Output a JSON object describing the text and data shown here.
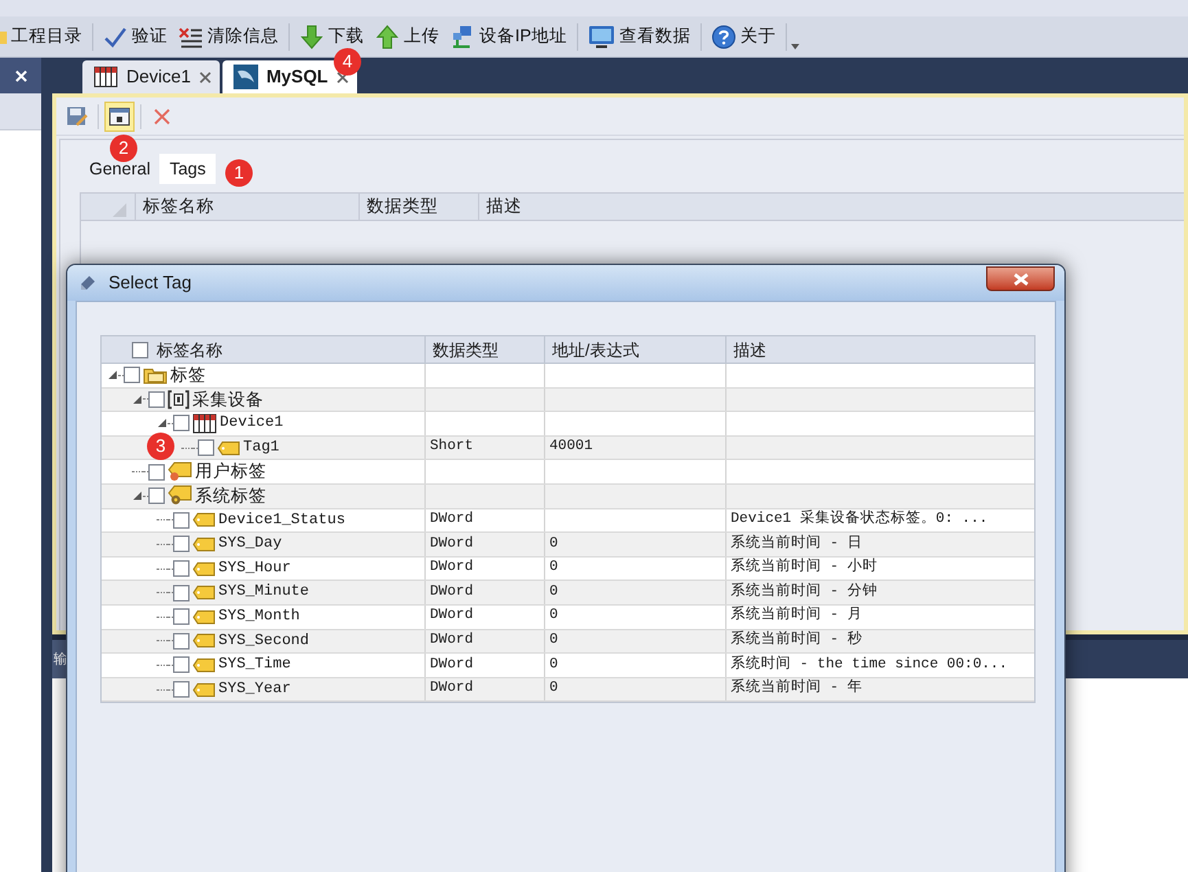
{
  "toolbar": [
    {
      "label": "工程目录",
      "kind": "folder"
    },
    {
      "label": "验证",
      "kind": "check"
    },
    {
      "label": "清除信息",
      "kind": "clear"
    },
    {
      "label": "下载",
      "kind": "download"
    },
    {
      "label": "上传",
      "kind": "upload"
    },
    {
      "label": "设备IP地址",
      "kind": "network"
    },
    {
      "label": "查看数据",
      "kind": "monitor"
    },
    {
      "label": "关于",
      "kind": "help"
    }
  ],
  "document_tabs": [
    {
      "label": "Device1",
      "kind": "device",
      "selected": false
    },
    {
      "label": "MySQL",
      "kind": "database",
      "selected": true
    }
  ],
  "editor": {
    "tools": [
      {
        "kind": "save",
        "hover": false
      },
      {
        "kind": "add",
        "hover": true
      },
      {
        "kind": "delete",
        "hover": false
      }
    ],
    "tabs": [
      {
        "label": "General",
        "selected": false
      },
      {
        "label": "Tags",
        "selected": true
      }
    ],
    "columns": [
      "标签名称",
      "数据类型",
      "描述"
    ]
  },
  "output_panel": {
    "title": "输"
  },
  "dialog": {
    "title": "Select Tag",
    "all_checked": false,
    "columns": [
      "标签名称",
      "数据类型",
      "地址/表达式",
      "描述"
    ],
    "tree": [
      {
        "name": "标签",
        "kind": "root",
        "checked": false,
        "expanded": true,
        "children": [
          {
            "name": "采集设备",
            "kind": "collector",
            "checked": false,
            "expanded": true,
            "children": [
              {
                "name": "Device1",
                "kind": "device",
                "checked": false,
                "expanded": true,
                "children": [
                  {
                    "name": "Tag1",
                    "kind": "tag",
                    "checked": false,
                    "type": "Short",
                    "address": "40001"
                  }
                ]
              }
            ]
          },
          {
            "name": "用户标签",
            "kind": "user",
            "checked": false
          },
          {
            "name": "系统标签",
            "kind": "system",
            "checked": false,
            "expanded": true,
            "children": [
              {
                "name": "Device1_Status",
                "kind": "tag",
                "checked": false,
                "type": "DWord",
                "description": "Device1 采集设备状态标签。0: ..."
              },
              {
                "name": "SYS_Day",
                "kind": "tag",
                "checked": false,
                "type": "DWord",
                "address": "0",
                "description": "系统当前时间 - 日"
              },
              {
                "name": "SYS_Hour",
                "kind": "tag",
                "checked": false,
                "type": "DWord",
                "address": "0",
                "description": "系统当前时间 - 小时"
              },
              {
                "name": "SYS_Minute",
                "kind": "tag",
                "checked": false,
                "type": "DWord",
                "address": "0",
                "description": "系统当前时间 - 分钟"
              },
              {
                "name": "SYS_Month",
                "kind": "tag",
                "checked": false,
                "type": "DWord",
                "address": "0",
                "description": "系统当前时间 - 月"
              },
              {
                "name": "SYS_Second",
                "kind": "tag",
                "checked": false,
                "type": "DWord",
                "address": "0",
                "description": "系统当前时间 - 秒"
              },
              {
                "name": "SYS_Time",
                "kind": "tag",
                "checked": false,
                "type": "DWord",
                "address": "0",
                "description": "系统时间 - the time since 00:0..."
              },
              {
                "name": "SYS_Year",
                "kind": "tag",
                "checked": false,
                "type": "DWord",
                "address": "0",
                "description": "系统当前时间 - 年"
              }
            ]
          }
        ]
      }
    ]
  },
  "callouts": [
    {
      "label": "1"
    },
    {
      "label": "2"
    },
    {
      "label": "3"
    },
    {
      "label": "4"
    }
  ]
}
